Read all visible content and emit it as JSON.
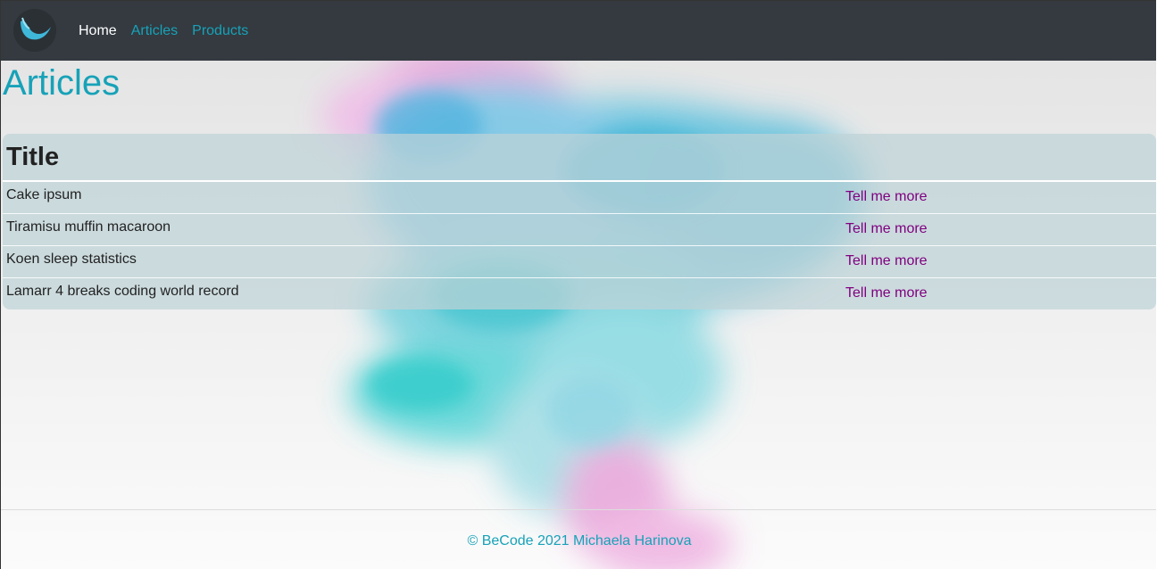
{
  "nav": {
    "logo": "logo-icon",
    "links": [
      {
        "label": "Home",
        "active": true
      },
      {
        "label": "Articles",
        "active": false
      },
      {
        "label": "Products",
        "active": false
      }
    ]
  },
  "page": {
    "title": "Articles"
  },
  "table": {
    "header": "Title",
    "rows": [
      {
        "title": "Cake ipsum",
        "link": "Tell me more"
      },
      {
        "title": "Tiramisu muffin macaroon",
        "link": "Tell me more"
      },
      {
        "title": "Koen sleep statistics",
        "link": "Tell me more"
      },
      {
        "title": "Lamarr 4 breaks coding world record",
        "link": "Tell me more"
      }
    ]
  },
  "footer": {
    "text": "© BeCode 2021 Michaela Harinova"
  },
  "colors": {
    "navbar": "#343a40",
    "accent": "#17a2b8",
    "link": "#800080"
  }
}
